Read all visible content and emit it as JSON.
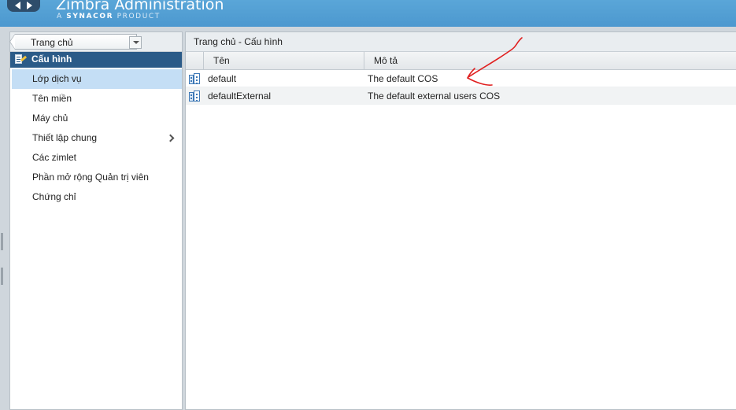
{
  "header": {
    "title": "Zimbra Administration",
    "subtitle_prefix": "A",
    "subtitle_brand": "SYNACOR",
    "subtitle_suffix": "PRODUCT",
    "accent_color": "#4c98cf"
  },
  "sidebar": {
    "breadcrumb_select": "Trang chủ",
    "section_title": "Cấu hình",
    "items": [
      {
        "label": "Lớp dịch vụ",
        "selected": true
      },
      {
        "label": "Tên miền"
      },
      {
        "label": "Máy chủ"
      },
      {
        "label": "Thiết lập chung",
        "has_submenu": true
      },
      {
        "label": "Các zimlet"
      },
      {
        "label": "Phần mở rộng Quản trị viên"
      },
      {
        "label": "Chứng chỉ"
      }
    ]
  },
  "main": {
    "breadcrumb": "Trang chủ - Cấu hình",
    "columns": {
      "name": "Tên",
      "description": "Mô tả"
    },
    "rows": [
      {
        "name": "default",
        "description": "The default COS"
      },
      {
        "name": "defaultExternal",
        "description": "The default external users COS"
      }
    ]
  },
  "icons": {
    "nav_back": "left-arrow-icon",
    "nav_forward": "right-arrow-icon",
    "section": "configuration-icon",
    "row": "cos-icon",
    "submenu": "chevron-right-icon"
  },
  "annotation": {
    "type": "hand-drawn red arrow",
    "color": "#e02020"
  }
}
